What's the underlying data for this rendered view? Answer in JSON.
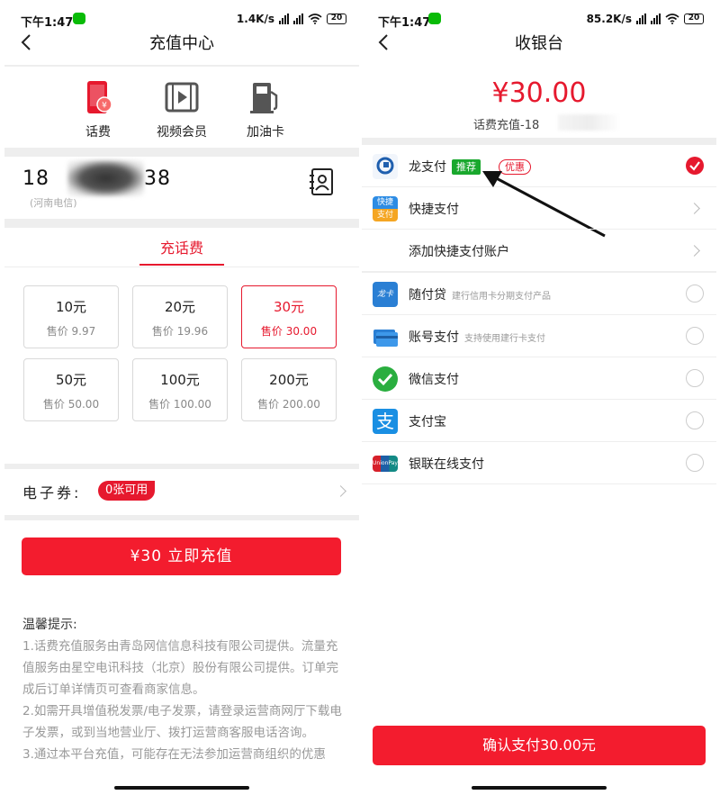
{
  "status_left": {
    "time": "下午1:47",
    "speed": "1.4K/s",
    "battery": "20"
  },
  "status_right": {
    "time": "下午1:47",
    "speed": "85.2K/s",
    "battery": "20"
  },
  "recharge": {
    "title": "充值中心",
    "categories": [
      {
        "label": "话费",
        "icon": "phone-bill-icon"
      },
      {
        "label": "视频会员",
        "icon": "video-membership-icon"
      },
      {
        "label": "加油卡",
        "icon": "fuel-card-icon"
      }
    ],
    "phone_number_start": "18",
    "phone_number_end": "38",
    "carrier": "(河南电信)",
    "tab": "充话费",
    "options": [
      {
        "face": "10元",
        "price": "售价 9.97"
      },
      {
        "face": "20元",
        "price": "售价 19.96"
      },
      {
        "face": "30元",
        "price": "售价 30.00"
      },
      {
        "face": "50元",
        "price": "售价 50.00"
      },
      {
        "face": "100元",
        "price": "售价 100.00"
      },
      {
        "face": "200元",
        "price": "售价 200.00"
      }
    ],
    "selected_option": "30元",
    "voucher_label": "电子券:",
    "voucher_badge": "0张可用",
    "pay_button": "¥30  立即充值",
    "tips_title": "温馨提示:",
    "tips_body": "1.话费充值服务由青岛网信信息科技有限公司提供。流量充值服务由星空电讯科技（北京）股份有限公司提供。订单完成后订单详情页可查看商家信息。\n2.如需开具增值税发票/电子发票，请登录运营商网厅下载电子发票，或到当地营业厅、拨打运营商客服电话咨询。\n3.通过本平台充值，可能存在无法参加运营商组织的优惠"
  },
  "cashier": {
    "title": "收银台",
    "amount": "¥30.00",
    "order_desc": "话费充值-18",
    "methods": [
      {
        "name": "龙支付",
        "tag": "推荐",
        "promo": "优惠",
        "selected": true,
        "icon": "long-pay-icon"
      },
      {
        "name": "快捷支付",
        "icon": "quick-pay-icon",
        "icon_text_top": "快捷",
        "icon_text_bottom": "支付"
      },
      {
        "name": "添加快捷支付账户"
      },
      {
        "name": "随付贷",
        "sub": "建行信用卡分期支付产品",
        "icon": "credit-card-icon",
        "icon_text": "龙卡"
      },
      {
        "name": "账号支付",
        "sub": "支持使用建行卡支付",
        "icon": "account-card-icon"
      },
      {
        "name": "微信支付",
        "icon": "wechat-pay-icon"
      },
      {
        "name": "支付宝",
        "icon": "alipay-icon",
        "icon_text": "支"
      },
      {
        "name": "银联在线支付",
        "icon": "unionpay-icon",
        "icon_text": "UnionPay"
      }
    ],
    "confirm_button": "确认支付30.00元"
  },
  "colors": {
    "accent": "#e6192e",
    "button": "#f31c2e",
    "recommend": "#19a82d"
  }
}
